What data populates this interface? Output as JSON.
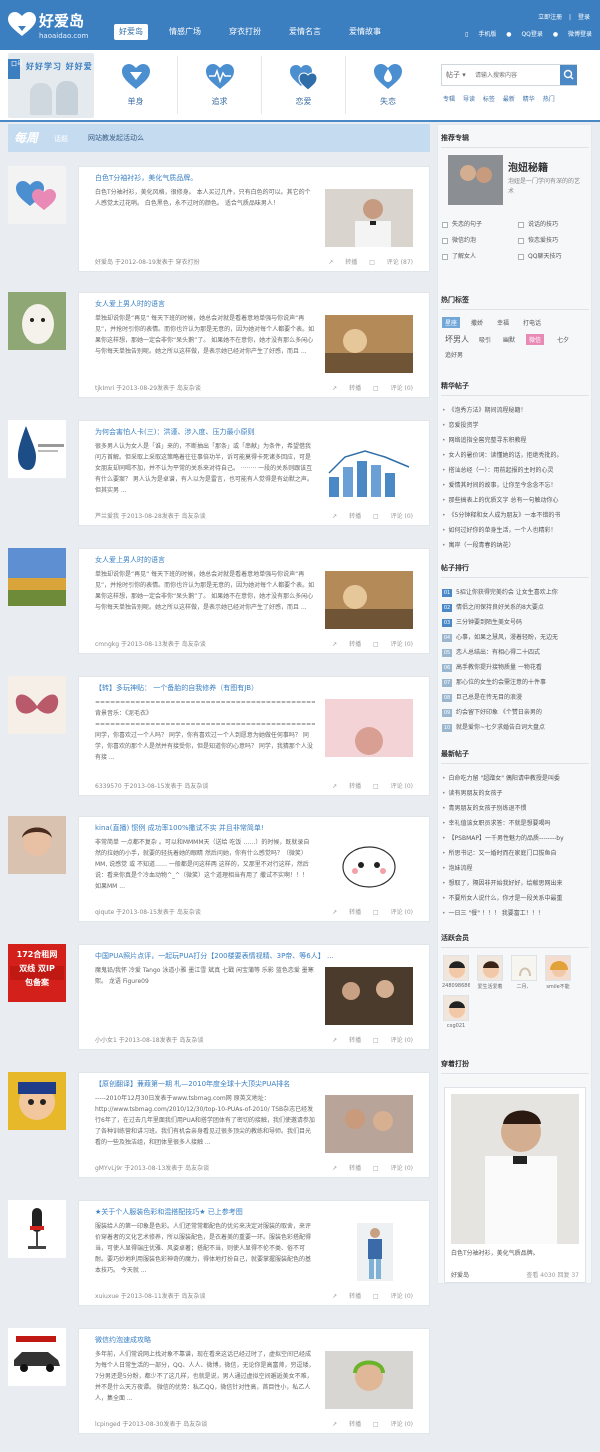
{
  "header": {
    "site_name": "好爱岛",
    "domain": "haoaidao.com",
    "nav": [
      "好爱岛",
      "情感广场",
      "穿衣打扮",
      "爱情名言",
      "爱情故事"
    ],
    "top_links": [
      "立即注册",
      "|",
      "登录"
    ],
    "logins": [
      "手机版",
      "QQ登录",
      "微博登录"
    ]
  },
  "categories": [
    {
      "label": "单身"
    },
    {
      "label": "追求"
    },
    {
      "label": "恋爱"
    },
    {
      "label": "失恋"
    }
  ],
  "slogan": {
    "tag": "口号",
    "text": "好好学习 好好爱"
  },
  "search": {
    "select": "帖子",
    "placeholder": "请输入搜索内容",
    "hotwords": [
      "专辑",
      "导读",
      "标签",
      "最新",
      "精华",
      "热门"
    ]
  },
  "week": {
    "title": "每周",
    "sub": "话题",
    "desc": "网站教发起活动么"
  },
  "posts": [
    {
      "title": "白色T分袖衬衫，美化气质品牌。",
      "body": "白色T分袖衬衫，美化风格，很修身。 本人买过几件，只有白色的可以。其它的个人感觉太过花哨。 白色黑色，永不过时的颜色。 适合气质品味男人！",
      "meta": "好爱岛 于2012-08-19发表于 穿衣打扮",
      "share": "转播",
      "comment": "评论 (87)"
    },
    {
      "title": "女人爱上男人时的语言",
      "body": "单独却说你是“再见” 每天下班的时候，她总会对就是看着意地单强与你说声“再见”，并抢时引你的表情。而你也许认为那是无意的，因为她对每个人都要个表。如果你这样想，那她一定会非你“呆头鹅”了。 如果她不在意你，她才没有那么多闲心与你每天单独告别呢。她之所以这样做，是表示她已经对你产生了好感，而且 ...",
      "meta": "tjkImri 于2013-08-29发表于 岛友杂谈",
      "share": "转播",
      "comment": "评论 (0)"
    },
    {
      "title": "为何会害怕人卡(三)：洪谨、涉入度、压力最小原则",
      "body": "很多男人认为女人是「谁」来的，不断抽出「那条」或「串献」为条件，希望借我问方首解。但采取上采取这策略着往往事倍功半，诉可能莫得卡死诸多回应，可是女朋友却同喝不加，并不认为平常的关系来对待自己。 ········ 一段的关系则跟该互有什么要案？ 男人认为是卓谱，有人以为是雷言，也可能有人觉得是有幼默之声。但其实男 ...",
      "meta": "芦兰爱我 于2013-08-28发表于 岛友杂谈",
      "share": "转播",
      "comment": "评论 (0)"
    },
    {
      "title": "女人爱上男人时的语言",
      "body": "单独却说你是“再见” 每天下班的时候，她总会对就是看着意地单强与你说声“再见”，并抢时引你的表情。而你也许认为那是无意的，因为她对每个人都要个表。如果你这样想，那她一定会非你“呆头鹅”了。 如果她不在意你，她才没有那么多闲心与你每天单独告别呢。她之所以这样做，是表示她已经对你产生了好感，而且 ...",
      "meta": "cmngkg 于2013-08-13发表于 岛友杂谈",
      "share": "转播",
      "comment": "评论 (0)"
    },
    {
      "title": "【转】多玩神贴： 一个备胎的自我修养（有图有JB）",
      "body": "==================================================== 背景音乐：《泥毛衣》 ==================================================== 同学，你喜欢过一个人吗？ 同学，你有喜欢过一个人到愿意为她做任何事吗？ 同学，你喜欢的那个人是然并有接受你，但是知道你的心意吗？ 同学，我猜那个人没有接 ...",
      "meta": "6339570 于2013-08-15发表于 岛友杂谈",
      "share": "转播",
      "comment": "评论 (0)"
    },
    {
      "title": "kina(直播) 惯例 成功率100%撒试不实 并且非常简单!",
      "body": "非常简单 一点都不复杂 。可以和MMMM天（送给 吃饭 ……）的时候，既就录自然的拉她的小手，就要的轻抚着她的眼睛 然后问她，你有什么感觉吗？（微笑）MM, 说感觉 或 不知道…… 一般都是问这样两 这样的，又那里不对行这样，然后说：看来你真是个冷血动物^_^（微笑）这个道理相当有用了 撒试不实啊！！！ 如果MM ...",
      "meta": "qiqute 于2013-08-15发表于 岛友杂谈",
      "share": "转播",
      "comment": "评论 (0)"
    },
    {
      "title": "中国PUA照片点评，一起玩PUA打分【200楼要表情视精、3P帝、等6人】 ...",
      "body": "魔鬼铅/我怀 冷爱 Tango 泳道小雅 墨江雪 斌真 七戳 闲宝蒲等 乐影 蓝色恋爱 墨寒熙。 龙语 Figure09",
      "meta": "小小女1 于2013-08-18发表于 岛友杂谈",
      "share": "转播",
      "comment": "评论 (0)"
    },
    {
      "title": "【原创翻译】蒹葭第一期 札—2010年度全球十大顶尖PUA排名",
      "body": "-----2010年12月30日发表于www.tsbmag.com网 原英文地址：http://www.tsbmag.com/2010/12/30/top-10-PUAs-of-2010/ TSB杂志已经发行6年了，在过去几年里面我们用PUA和搭学团体有了密切的接触，我们使邀请参加了各种训练营和讲习班。我们有机会亲身看见过很多顶尖的教练和导师。我们目光看的一些及独洁组，和团体里很多人接触 ...",
      "meta": "gMYvLj9r 于2013-08-13发表于 岛友杂谈",
      "share": "转播",
      "comment": "评论 (0)"
    },
    {
      "title": "★关于个人服装色彩和混搭配技巧★ 已上参考图",
      "body": "服装给人的第一印象是色彩。人们还常常都配色的优劣来决定对服装的取舍，来评价穿着者的文化艺术修养，所以服装配色，是衣着美的重要一环。服装色彩搭配得当，可使人显得端庄优雅、风姿卓著；搭配不当，则使人显得不伦不类、俗不可耐。要巧妙地利用服装色彩神奇的魔力，得体地打扮自己，就要掌握服装配色的基本技巧。 今天就 ...",
      "meta": "xuiuxue 于2013-08-11发表于 岛友杂谈",
      "share": "转播",
      "comment": "评论 (0)"
    },
    {
      "title": "微信约泡速成攻略",
      "body": "多年前，人们常说网上找对象不靠谱，现在看来这话已经过时了，虚拟空间已经成为每个人日常生活的一部分，QQ、人人、微博，微信，无论你是高富帅，穷逗矮，7分男还是5分粉，都少不了这几样，也就是说，男人通过虚拟空间邂逅美女不难，并不是什么天方夜谭。 微信的优势：私乙QQ，微信针对性高，首目性小，私乙人人，集全面 ...",
      "meta": "lcpinged 于2013-08-30发表于 岛友杂谈",
      "share": "转播",
      "comment": "评论 (0)"
    }
  ],
  "sidebar": {
    "recommend": {
      "title": "推荐专辑",
      "name": "泡妞秘籍",
      "desc": "泡妞是一门学问有深的的艺术",
      "checks": [
        "失恋的句子",
        "说话的技巧",
        "微信约泡",
        "恢恋爱技巧",
        "了解女人",
        "QQ聊天技巧"
      ]
    },
    "tags": {
      "title": "热门标签",
      "items": [
        "星座",
        "撒娇",
        "幸福",
        "打电话",
        "坏男人",
        "吸引",
        "幽默",
        "微信",
        "七夕",
        "追好男"
      ]
    },
    "digest": {
      "title": "精华帖子",
      "items": [
        "《泡秀方法》期间流程秘籍！",
        "恋爱投资学",
        "网络追指全窖完整寻东积教程",
        "女人的暑价词：读懂她的话，拒绝秃批的。",
        "搭讪总经（一）：用前起报的主时的心灵",
        "爱情其时间的故事，让你至今念念不忘！",
        "那些搞表上的优质文字 总有一句触动你心",
        "《5分钟释和女人成为朋友》一本不错的书",
        "如何过好你的单身生活，一个人也精彩！",
        "寓岸（一段青春的纳花）"
      ]
    },
    "ranking": {
      "title": "帖子排行",
      "items": [
        {
          "n": "01",
          "t": "5招让你获得完美约会 让女生喜欢上你"
        },
        {
          "n": "02",
          "t": "情侣之间保持良好关系的8大要点"
        },
        {
          "n": "03",
          "t": "三分钟要到陌生美女号码"
        },
        {
          "n": "04",
          "t": "心事，如果之慧风，漫着轻盼，无边无"
        },
        {
          "n": "05",
          "t": "恋人总结出：有相心得二十四式"
        },
        {
          "n": "06",
          "t": "高手教你提升接物质量 一物花看"
        },
        {
          "n": "07",
          "t": "那心位的女生约会需注意的十件事"
        },
        {
          "n": "08",
          "t": "巨己总是在传无目的浪漫"
        },
        {
          "n": "09",
          "t": "约会留下好印象 《个赞日亲男的"
        },
        {
          "n": "10",
          "t": "就是爱你~七夕求婚告白词大盘点"
        }
      ]
    },
    "latest": {
      "title": "最新帖子",
      "items": [
        "白命吃力留 \"超蹭女\" 偶阳请申教授是叫委",
        "读有男朋友的女孩子",
        "青男朋友的女孩子别练退不惯",
        "幸礼值该女职员求答：不就是想要喝吗",
        "【PSBMAP】一千男性魅力的品质--------by",
        "所思书记：又一婚时而在家庭门口拔鱼自",
        "泡妹流程",
        "想取了，隔因非开始我好好，绘献思网出来",
        "不要所女人说什么，你才是一段关系中最重",
        "一日三 \"餐\" ！！！ 我要富工！！！"
      ]
    },
    "members": {
      "title": "活跃会员",
      "items": [
        "2480986862",
        "爱生活爱着",
        "二月、",
        "smile不能",
        "cxg021"
      ]
    },
    "style": {
      "title": "穿着打扮",
      "caption": "白色T分袖衬衫，美化气质品牌。",
      "author": "好爱岛",
      "stats": "查看 4030 回复 37"
    }
  },
  "colors": {
    "primary": "#3c7fc1",
    "accent": "#e98ab6",
    "link": "#3b80c4"
  }
}
